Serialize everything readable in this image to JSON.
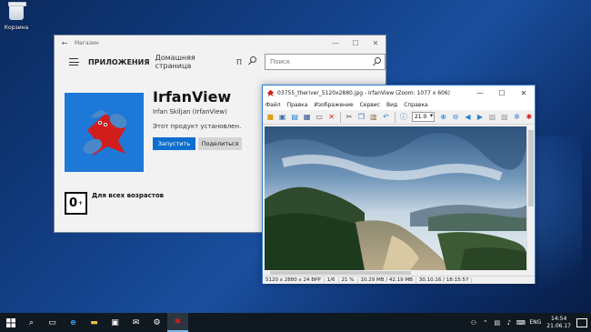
{
  "desktop": {
    "recycle_bin_label": "Корзина"
  },
  "store": {
    "title": "Магазин",
    "nav": {
      "apps": "ПРИЛОЖЕНИЯ",
      "home": "Домашняя страница",
      "p": "П"
    },
    "search": {
      "placeholder": "Поиск"
    },
    "app": {
      "name": "IrfanView",
      "publisher": "Irfan Skiljan (IrfanView)",
      "status": "Этот продукт установлен.",
      "launch_label": "Запустить",
      "share_label": "Поделиться"
    },
    "rating": {
      "age": "0",
      "plus": "+",
      "text": "Для всех возрастов"
    }
  },
  "irfanview": {
    "title": "03755_theriver_5120x2880.jpg - IrfanView (Zoom: 1077 x 606)",
    "menu": [
      "Файл",
      "Правка",
      "Изображение",
      "Сервис",
      "Вид",
      "Справка"
    ],
    "zoom_value": "21.0",
    "status": [
      "5120 x 2880 x 24 BPP",
      "1/6",
      "21 %",
      "10.29 MB / 42.19 MB",
      "30.10.16 / 18:15:57"
    ]
  },
  "taskbar": {
    "tray": {
      "lang": "ENG",
      "time": "14:54",
      "date": "21.06.17"
    }
  },
  "colors": {
    "store_tile": "#1e78d7",
    "launch_button": "#0f6fce",
    "taskbar": "#101820",
    "irfan_border": "#2b7bd4"
  }
}
